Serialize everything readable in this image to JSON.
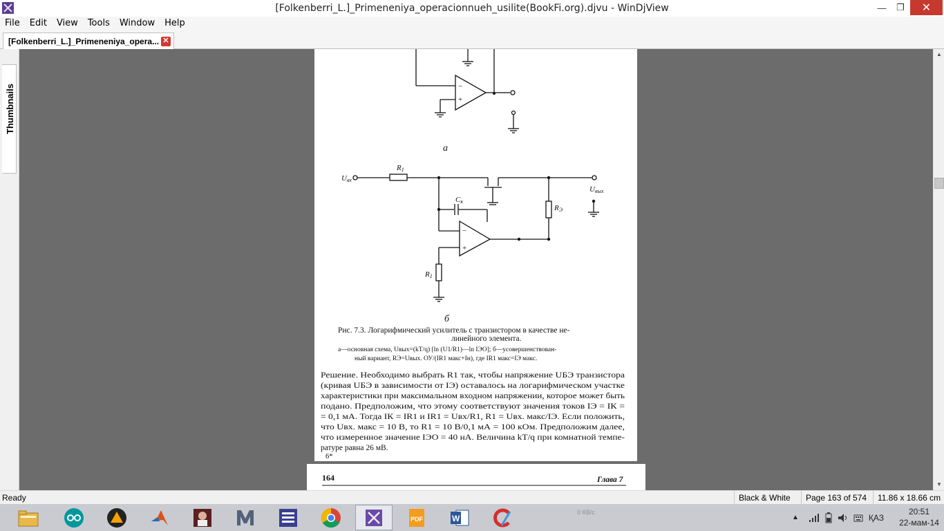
{
  "window": {
    "title": "[Folkenberri_L.]_Primeneniya_operacionnueh_usilite(BookFi.org).djvu - WinDjView",
    "minimize": "—",
    "maximize": "❐",
    "close": "✕"
  },
  "menu": [
    "File",
    "Edit",
    "View",
    "Tools",
    "Window",
    "Help"
  ],
  "tab": {
    "label": "[Folkenberri_L.]_Primeneniya_opera...",
    "close": "✕"
  },
  "sidebar": {
    "thumbnails_label": "Thumbnails"
  },
  "document": {
    "diagram_a_label": "а",
    "diagram_b_label": "б",
    "label_uvx": "U",
    "label_uvx_sub": "вх",
    "label_uvyx": "U",
    "label_uvyx_sub": "вых",
    "label_r1": "R",
    "label_r1_sub": "1",
    "label_ck": "C",
    "label_ck_sub": "к",
    "label_re": "R",
    "label_re_sub": "Э",
    "label_r1b": "R",
    "label_r1b_sub": "1",
    "caption_title": "Рис. 7.3. Логарифмический усилитель с транзистором в качестве не-",
    "caption_title_2": "линейного элемента.",
    "caption_line_1": "а—основная схема, Uвых=(kT/q) [ln (U1/R1)—ln IЭО];  б—усовершенствован-",
    "caption_line_2": "ный вариант, RЭ=Uвых. ОУ/(IR1 макс+Iн), где IR1 макс=IЭ макс.",
    "body_lines": [
      "Решение. Необходимо выбрать R1 так, чтобы напряжение UБЭ транзистора",
      "(кривая UБЭ  в зависимости от IЭ)  оставалось на логарифмическом участке",
      "характеристики при максимальном входном напряжении, которое может быть",
      "подано. Предположим, что этому соответствуют значения токов IЭ = IК =",
      "= 0,1 мА. Тогда IК = IR1 и IR1 = Uвх/R1, R1 = Uвх. макс/IЭ. Если положить,",
      "что Uвх. макс = 10 В, то R1 = 10 В/0,1 мА = 100 кОм. Предположим далее,",
      "что измеренное значение IЭО = 40 нА.  Величина kT/q при комнатной темпе-",
      "ратуре равна  26 мВ."
    ],
    "footnote_mark": "6*",
    "next_page_number": "164",
    "next_page_header": "Глава 7"
  },
  "status": {
    "ready": "Ready",
    "mode": "Black & White",
    "page": "Page 163 of 574",
    "size": "11.86 x 18.66 cm"
  },
  "taskbar": {
    "apps": [
      "file-explorer",
      "arduino",
      "aimp",
      "matlab",
      "game-fifa",
      "mathcad",
      "eq-app",
      "chrome",
      "windjview",
      "pdf-editor",
      "word",
      "ccleaner"
    ],
    "active_app": "windjview",
    "net_speed": "0 КВ/с",
    "language": "ҚАЗ",
    "time": "20:51",
    "date": "22-мам-14"
  },
  "colors": {
    "viewer_bg": "#6c6c6c",
    "close_red": "#c7392f",
    "taskbar": "#c9cbd0"
  }
}
